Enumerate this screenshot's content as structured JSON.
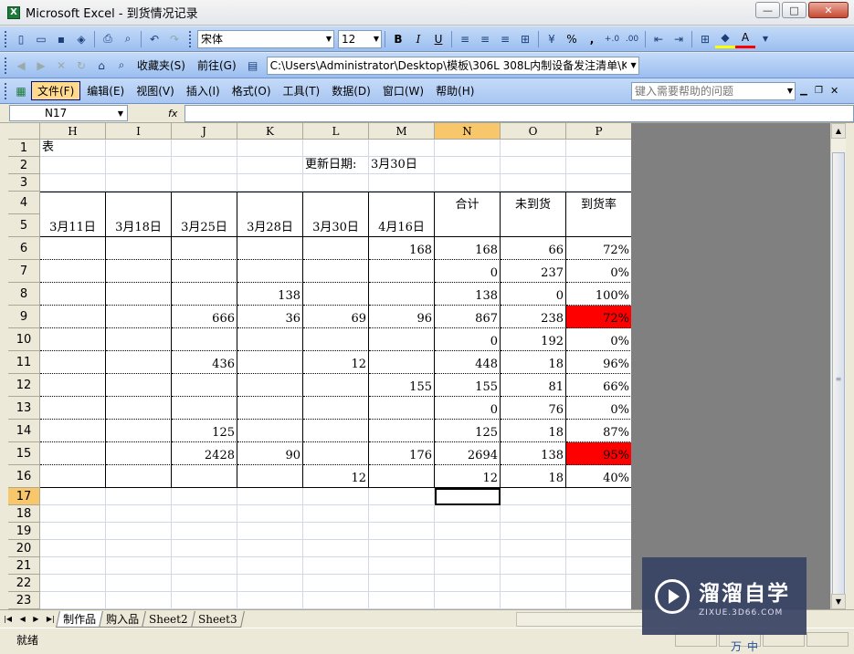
{
  "window": {
    "title": "Microsoft Excel - 到货情况记录",
    "app_icon": "X",
    "minimize": "—",
    "maximize": "□",
    "close": "✕"
  },
  "toolbar1": {
    "font_name": "宋体",
    "font_size": "12",
    "buttons": [
      "new",
      "open",
      "save",
      "permission",
      "print",
      "preview",
      "undo",
      "redo",
      "bold",
      "italic",
      "underline",
      "align-left",
      "align-center",
      "align-right",
      "merge",
      "currency",
      "percent",
      "comma",
      "increase-decimal",
      "decrease-decimal",
      "decrease-indent",
      "increase-indent",
      "borders",
      "fill-color",
      "font-color"
    ],
    "bold_label": "B",
    "italic_label": "I",
    "underline_label": "U",
    "percent_label": "%",
    "comma_label": ","
  },
  "toolbar2": {
    "favorites_label": "收藏夹(S)",
    "goto_label": "前往(G)",
    "address": "C:\\Users\\Administrator\\Desktop\\模板\\306L 308L内制设备发注清单\\K"
  },
  "menubar": {
    "items": [
      "文件(F)",
      "编辑(E)",
      "视图(V)",
      "插入(I)",
      "格式(O)",
      "工具(T)",
      "数据(D)",
      "窗口(W)",
      "帮助(H)"
    ],
    "help_placeholder": "键入需要帮助的问题"
  },
  "formulabar": {
    "name_box": "N17",
    "fx": "fx",
    "content": ""
  },
  "columns": [
    "H",
    "I",
    "J",
    "K",
    "L",
    "M",
    "N",
    "O",
    "P"
  ],
  "selected_column": "N",
  "rows": [
    "1",
    "2",
    "3",
    "4",
    "5",
    "6",
    "7",
    "8",
    "9",
    "10",
    "11",
    "12",
    "13",
    "14",
    "15",
    "16",
    "17",
    "18",
    "19",
    "20",
    "21",
    "22",
    "23"
  ],
  "selected_row": "17",
  "cells": {
    "H1": "表",
    "L2": "更新日期:",
    "M2": "3月30日",
    "N4": "合计",
    "O4": "未到货",
    "P4": "到货率",
    "H5": "3月11日",
    "I5": "3月18日",
    "J5": "3月25日",
    "K5": "3月28日",
    "L5": "3月30日",
    "M5": "4月16日",
    "M6": "168",
    "N6": "168",
    "O6": "66",
    "P6": "72%",
    "N7": "0",
    "O7": "237",
    "P7": "0%",
    "K8": "138",
    "N8": "138",
    "O8": "0",
    "P8": "100%",
    "J9": "666",
    "K9": "36",
    "L9": "69",
    "M9": "96",
    "N9": "867",
    "O9": "238",
    "P9": "72%",
    "N10": "0",
    "O10": "192",
    "P10": "0%",
    "J11": "436",
    "L11": "12",
    "N11": "448",
    "O11": "18",
    "P11": "96%",
    "M12": "155",
    "N12": "155",
    "O12": "81",
    "P12": "66%",
    "N13": "0",
    "O13": "76",
    "P13": "0%",
    "J14": "125",
    "N14": "125",
    "O14": "18",
    "P14": "87%",
    "J15": "2428",
    "K15": "90",
    "M15": "176",
    "N15": "2694",
    "O15": "138",
    "P15": "95%",
    "L16": "12",
    "N16": "12",
    "O16": "18",
    "P16": "40%"
  },
  "highlight_color": "#ff0000",
  "highlighted_cells": [
    "P9",
    "P15"
  ],
  "sheets": [
    "制作品",
    "购入品",
    "Sheet2",
    "Sheet3"
  ],
  "active_sheet": "制作品",
  "status": "就绪",
  "watermark": {
    "main": "溜溜自学",
    "sub": "ZIXUE.3D66.COM"
  },
  "ime": [
    "万",
    "中"
  ]
}
